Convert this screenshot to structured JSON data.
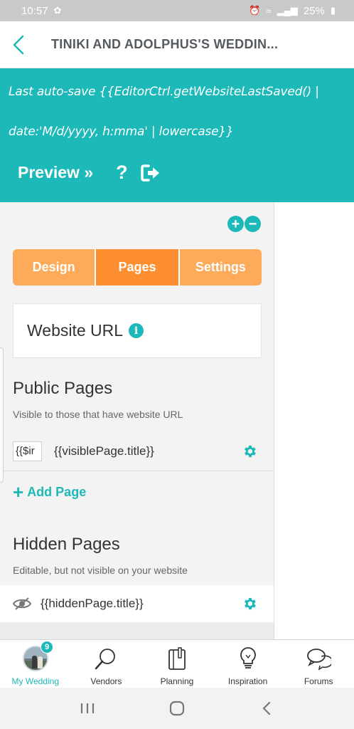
{
  "status_bar": {
    "time": "10:57",
    "battery": "25%"
  },
  "header": {
    "title": "TINIKI AND ADOLPHUS'S WEDDIN..."
  },
  "editor_bar": {
    "autosave_line1": "Last auto-save {{EditorCtrl.getWebsiteLastSaved() |",
    "autosave_line2": "date:'M/d/yyyy, h:mma' | lowercase}}",
    "preview_label": "Preview »",
    "help_label": "?"
  },
  "panel": {
    "tabs": [
      {
        "label": "Design",
        "active": false
      },
      {
        "label": "Pages",
        "active": true
      },
      {
        "label": "Settings",
        "active": false
      }
    ],
    "website_url_label": "Website URL",
    "public_pages": {
      "title": "Public Pages",
      "subtitle": "Visible to those that have website URL",
      "row_input_value": "{{$ir",
      "row_title": "{{visiblePage.title}}"
    },
    "add_page_label": "Add Page",
    "hidden_pages": {
      "title": "Hidden Pages",
      "subtitle": "Editable, but not visible on your website",
      "row_title": "{{hiddenPage.title}}"
    }
  },
  "bottom_nav": {
    "items": [
      {
        "label": "My Wedding",
        "active": true,
        "badge": "9"
      },
      {
        "label": "Vendors",
        "active": false
      },
      {
        "label": "Planning",
        "active": false
      },
      {
        "label": "Inspiration",
        "active": false
      },
      {
        "label": "Forums",
        "active": false
      }
    ]
  },
  "colors": {
    "teal": "#1db8b8",
    "orange_tab": "#fdaa5b",
    "orange_tab_active": "#fd8f30"
  }
}
